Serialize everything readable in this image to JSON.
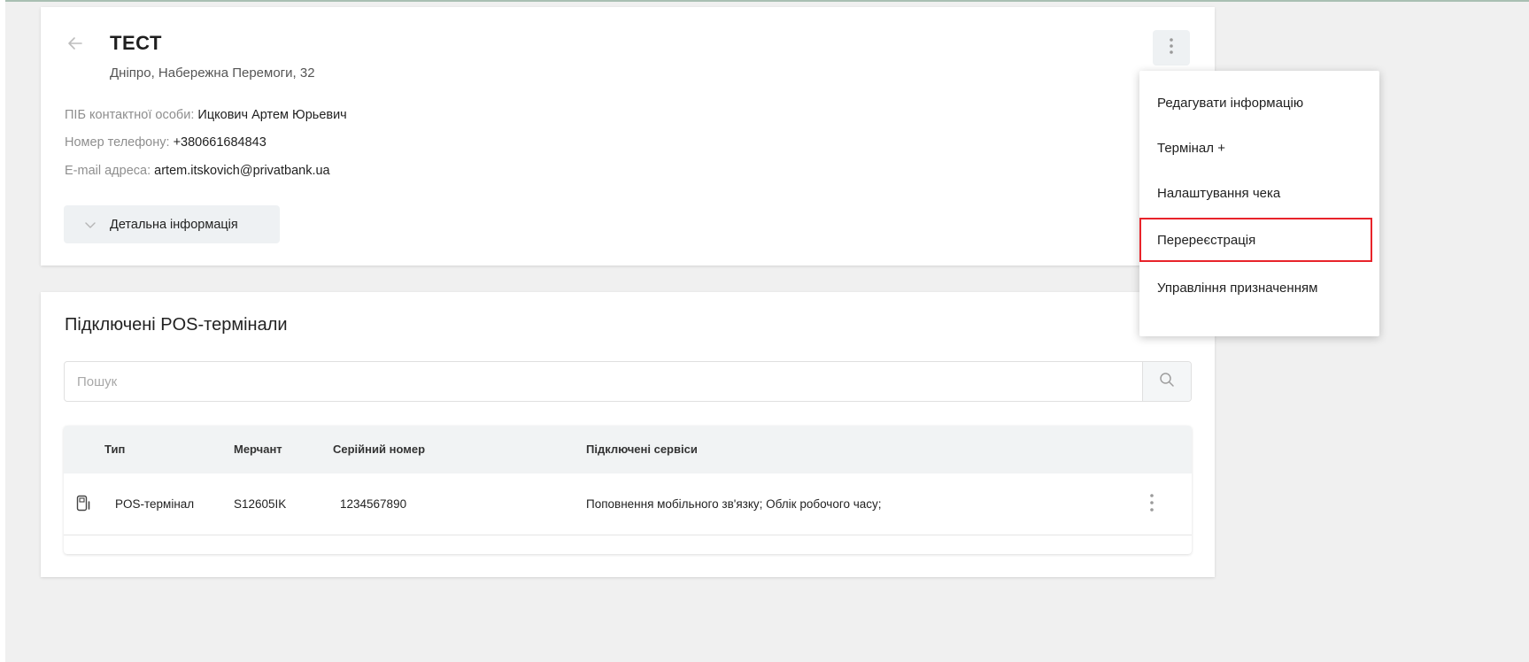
{
  "shop": {
    "title": "ТЕСТ",
    "address": "Дніпро, Набережна Перемоги, 32",
    "contact_label": "ПІБ контактної особи:",
    "contact_value": "Ицкович Артем Юрьевич",
    "phone_label": "Номер телефону:",
    "phone_value": "+380661684843",
    "email_label": "E-mail адреса:",
    "email_value": "artem.itskovich@privatbank.ua",
    "details_button": "Детальна інформація"
  },
  "menu": {
    "items": [
      {
        "label": "Редагувати інформацію"
      },
      {
        "label": "Термінал +"
      },
      {
        "label": "Налаштування чека"
      },
      {
        "label": "Перереєстрація"
      },
      {
        "label": "Управління призначенням"
      }
    ],
    "highlighted": "Перереєстрація"
  },
  "pos": {
    "section_title": "Підключені POS-термінали",
    "search_placeholder": "Пошук",
    "columns": [
      "Тип",
      "Мерчант",
      "Серійний номер",
      "Підключені сервіси"
    ],
    "rows": [
      {
        "type": "POS-термінал",
        "merchant": "S12605IK",
        "serial": "1234567890",
        "services": "Поповнення мобільного зв'язку; Облік робочого часу;"
      }
    ]
  },
  "colors": {
    "highlight_border": "#e8232a",
    "button_bg": "#eef1f3",
    "header_bg": "#f1f3f4"
  },
  "icons": [
    "back-arrow-icon",
    "chevron-down-icon",
    "more-vertical-icon",
    "search-icon",
    "pos-terminal-icon"
  ]
}
